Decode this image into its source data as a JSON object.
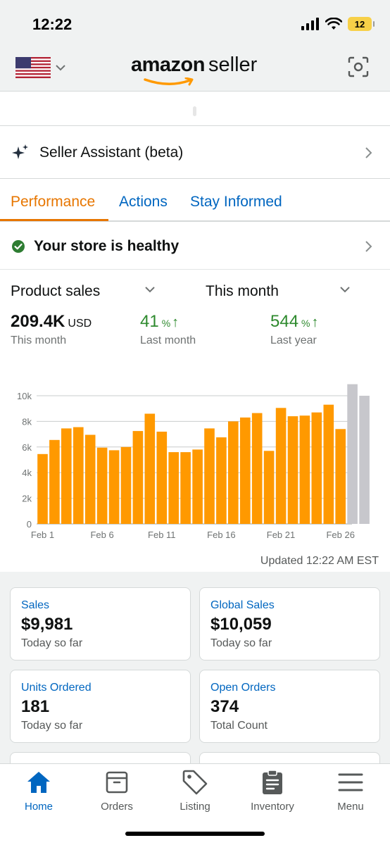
{
  "status": {
    "time": "12:22",
    "battery": "12"
  },
  "header": {
    "logo_amazon": "amazon",
    "logo_seller": "seller",
    "flag_icon": "us-flag-icon",
    "scan_icon": "scan-icon"
  },
  "assistant": {
    "label": "Seller Assistant (beta)",
    "icon": "sparkle-icon"
  },
  "tabs": [
    {
      "label": "Performance",
      "active": true
    },
    {
      "label": "Actions",
      "active": false
    },
    {
      "label": "Stay Informed",
      "active": false
    }
  ],
  "health": {
    "label": "Your store is healthy",
    "status_color": "#2e7d32"
  },
  "selectors": {
    "metric": "Product sales",
    "period": "This month"
  },
  "metrics": {
    "main": {
      "value": "209.4K",
      "unit": "USD",
      "label": "This month"
    },
    "last_month": {
      "value": "41",
      "unit": "%",
      "label": "Last month"
    },
    "last_year": {
      "value": "544",
      "unit": "%",
      "label": "Last year"
    }
  },
  "chart_data": {
    "type": "bar",
    "ylim": [
      0,
      10000
    ],
    "yticks": [
      "0",
      "2k",
      "4k",
      "6k",
      "8k",
      "10k"
    ],
    "xticks": [
      "Feb 1",
      "Feb 6",
      "Feb 11",
      "Feb 16",
      "Feb 21",
      "Feb 26"
    ],
    "categories": [
      "1",
      "2",
      "3",
      "4",
      "5",
      "6",
      "7",
      "8",
      "9",
      "10",
      "11",
      "12",
      "13",
      "14",
      "15",
      "16",
      "17",
      "18",
      "19",
      "20",
      "21",
      "22",
      "23",
      "24",
      "25",
      "26",
      "27",
      "28"
    ],
    "values": [
      5450,
      6550,
      7450,
      7550,
      6950,
      5950,
      5750,
      6000,
      7250,
      8600,
      7200,
      5600,
      5600,
      5800,
      7450,
      6750,
      8000,
      8300,
      8650,
      5700,
      9050,
      8400,
      8450,
      8700,
      9300,
      7400,
      10900,
      10000
    ],
    "colors": {
      "actual": "#ff9900",
      "projected": "#c7c7cc"
    },
    "projected_from_index": 26
  },
  "updated": "Updated 12:22 AM EST",
  "cards": [
    {
      "title": "Sales",
      "value": "$9,981",
      "sub": "Today so far"
    },
    {
      "title": "Global Sales",
      "value": "$10,059",
      "sub": "Today so far"
    },
    {
      "title": "Units Ordered",
      "value": "181",
      "sub": "Today so far"
    },
    {
      "title": "Open Orders",
      "value": "374",
      "sub": "Total Count"
    }
  ],
  "nav": [
    {
      "label": "Home",
      "icon": "home-icon",
      "active": true
    },
    {
      "label": "Orders",
      "icon": "orders-box-icon",
      "active": false
    },
    {
      "label": "Listing",
      "icon": "tag-icon",
      "active": false
    },
    {
      "label": "Inventory",
      "icon": "clipboard-icon",
      "active": false
    },
    {
      "label": "Menu",
      "icon": "hamburger-icon",
      "active": false
    }
  ]
}
